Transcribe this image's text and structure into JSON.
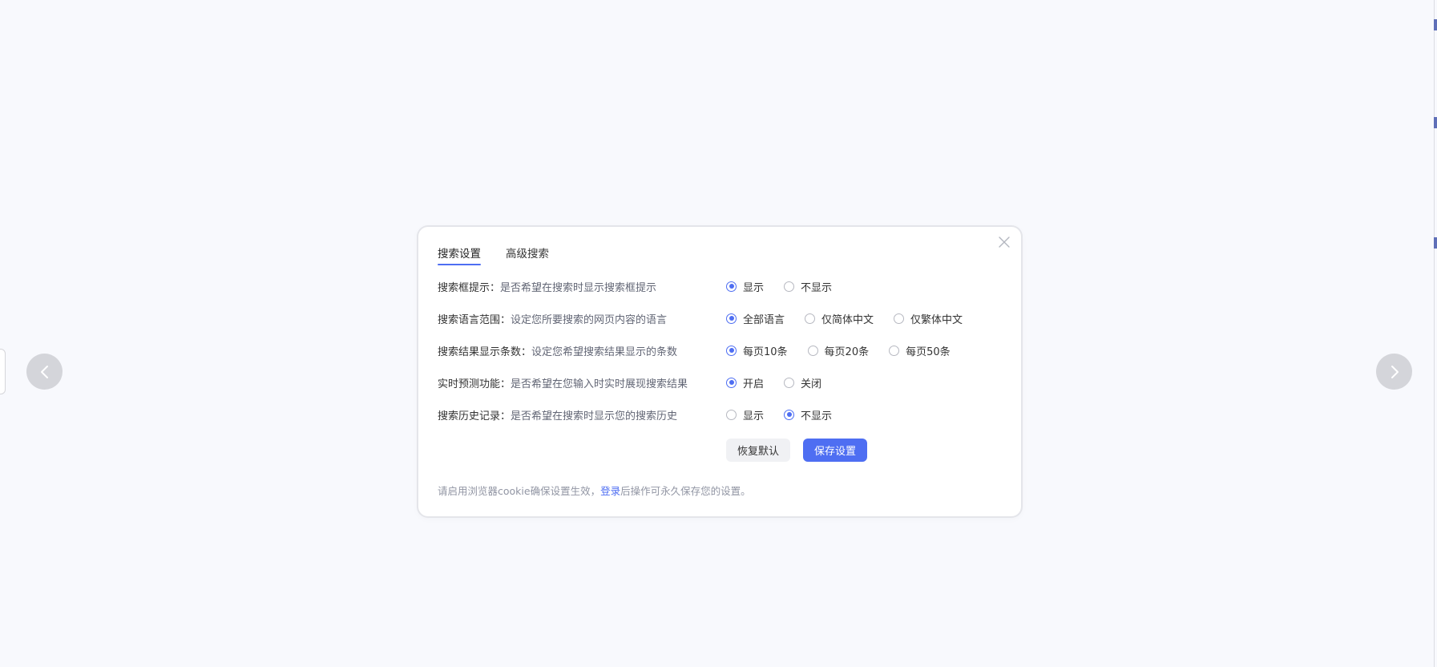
{
  "dialog": {
    "tabs": [
      {
        "label": "搜索设置",
        "active": true
      },
      {
        "label": "高级搜索",
        "active": false
      }
    ],
    "rows": [
      {
        "label": "搜索框提示：",
        "desc": "是否希望在搜索时显示搜索框提示",
        "options": [
          {
            "label": "显示",
            "checked": true
          },
          {
            "label": "不显示",
            "checked": false
          }
        ]
      },
      {
        "label": "搜索语言范围：",
        "desc": "设定您所要搜索的网页内容的语言",
        "options": [
          {
            "label": "全部语言",
            "checked": true
          },
          {
            "label": "仅简体中文",
            "checked": false
          },
          {
            "label": "仅繁体中文",
            "checked": false
          }
        ]
      },
      {
        "label": "搜索结果显示条数：",
        "desc": "设定您希望搜索结果显示的条数",
        "options": [
          {
            "label": "每页10条",
            "checked": true
          },
          {
            "label": "每页20条",
            "checked": false
          },
          {
            "label": "每页50条",
            "checked": false
          }
        ]
      },
      {
        "label": "实时预测功能：",
        "desc": "是否希望在您输入时实时展现搜索结果",
        "options": [
          {
            "label": "开启",
            "checked": true
          },
          {
            "label": "关闭",
            "checked": false
          }
        ]
      },
      {
        "label": "搜索历史记录：",
        "desc": "是否希望在搜索时显示您的搜索历史",
        "options": [
          {
            "label": "显示",
            "checked": false
          },
          {
            "label": "不显示",
            "checked": true
          }
        ]
      }
    ],
    "buttons": {
      "reset_label": "恢复默认",
      "save_label": "保存设置"
    },
    "footer": {
      "text_before": "请启用浏览器cookie确保设置生效，",
      "link_text": "登录",
      "text_after": "后操作可永久保存您的设置。"
    }
  },
  "colors": {
    "accent": "#4e6ef2",
    "background": "#f8f9fd"
  },
  "icons": {
    "close": "close-icon",
    "prev": "chevron-left-icon",
    "next": "chevron-right-icon"
  }
}
